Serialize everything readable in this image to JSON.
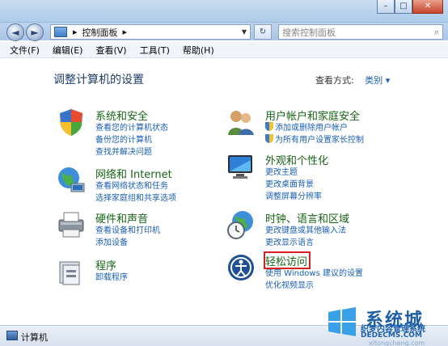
{
  "window": {
    "controls": {
      "minimize": "–",
      "maximize": "□",
      "close": "✕"
    }
  },
  "address": {
    "back": "◄",
    "forward": "►",
    "crumb": "控制面板",
    "crumb_arrow": "▸",
    "refresh": "↻",
    "search_placeholder": "搜索控制面板"
  },
  "menu": [
    "文件(F)",
    "编辑(E)",
    "查看(V)",
    "工具(T)",
    "帮助(H)"
  ],
  "main": {
    "heading": "调整计算机的设置",
    "view_by_label": "查看方式:",
    "view_by_value": "类别 ▾"
  },
  "categories": [
    {
      "title": "系统和安全",
      "links": [
        "查看您的计算机状态",
        "备份您的计算机",
        "查找并解决问题"
      ]
    },
    {
      "title": "网络和 Internet",
      "links": [
        "查看网络状态和任务",
        "选择家庭组和共享选项"
      ]
    },
    {
      "title": "硬件和声音",
      "links": [
        "查看设备和打印机",
        "添加设备"
      ]
    },
    {
      "title": "程序",
      "links": [
        "卸载程序"
      ]
    },
    {
      "title": "用户帐户和家庭安全",
      "links": [
        "添加或删除用户帐户",
        "为所有用户设置家长控制"
      ]
    },
    {
      "title": "外观和个性化",
      "links": [
        "更改主题",
        "更改桌面背景",
        "调整屏幕分辨率"
      ]
    },
    {
      "title": "时钟、语言和区域",
      "links": [
        "更改键盘或其他输入法",
        "更改显示语言"
      ]
    },
    {
      "title": "轻松访问",
      "links": [
        "使用 Windows 建议的设置",
        "优化视频显示"
      ]
    }
  ],
  "status": {
    "text": "计算机"
  },
  "watermark": {
    "big": "系统城",
    "line1": "织梦内容管理系统",
    "line2": "DEDECMS.COM",
    "line3": "xitongcheng.com"
  },
  "colors": {
    "category_title": "#176516",
    "link": "#1a5fb4",
    "highlight": "#d92020"
  }
}
